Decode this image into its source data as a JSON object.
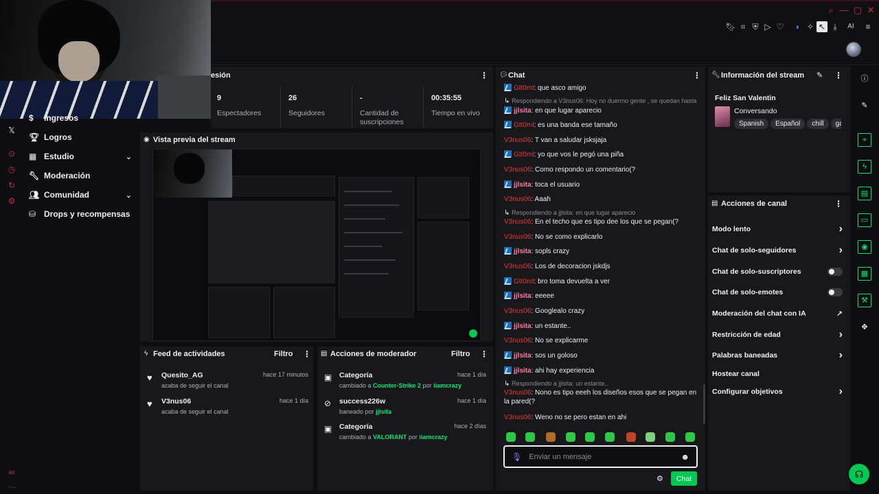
{
  "sidebar": {
    "items": [
      {
        "label": "Ingresos"
      },
      {
        "label": "Logros"
      },
      {
        "label": "Estudio"
      },
      {
        "label": "Moderación"
      },
      {
        "label": "Comunidad"
      },
      {
        "label": "Drops y recompensas"
      }
    ]
  },
  "session": {
    "title_fragment": "esión",
    "stats": [
      {
        "value": "9",
        "label": "Espectadores"
      },
      {
        "value": "26",
        "label": "Seguidores"
      },
      {
        "value": "-",
        "label": "Cantidad de suscripciones"
      },
      {
        "value": "00:35:55",
        "label": "Tiempo en vivo"
      }
    ]
  },
  "preview": {
    "title": "Vista previa del stream"
  },
  "activity": {
    "title": "Feed de actividades",
    "filter": "Filtro",
    "items": [
      {
        "user": "Quesito_AG",
        "desc": "acaba de seguir el canal",
        "time": "hace 17 minutos"
      },
      {
        "user": "V3nus06",
        "desc": "acaba de seguir el canal",
        "time": "hace 1 día"
      }
    ]
  },
  "modactions": {
    "title": "Acciones de moderador",
    "filter": "Filtro",
    "items": [
      {
        "title": "Categoría",
        "pre": "cambiado a",
        "target": "Counter-Strike 2",
        "by": "por",
        "who": "iiamcrazy",
        "time": "hace 1 día"
      },
      {
        "title": "success226w",
        "pre": "baneado por",
        "target": "jjlsita",
        "by": "",
        "who": "",
        "time": "hace 1 día"
      },
      {
        "title": "Categoría",
        "pre": "cambiado a",
        "target": "VALORANT",
        "by": "por",
        "who": "iiamcrazy",
        "time": "hace 2 días"
      }
    ]
  },
  "chat": {
    "title": "Chat",
    "placeholder": "Enviar un mensaje",
    "send_label": "Chat",
    "messages": [
      {
        "user": "Gtt0ml",
        "text": ": que asco amigo"
      },
      {
        "reply": "Respondiendo a V3nus06: Hoy no duermo gente , se quedan hasta ..."
      },
      {
        "user": "jjlsita",
        "text": ": en que lugar aparecio"
      },
      {
        "user": "Gtt0ml",
        "text": ": es una banda ese tamaño"
      },
      {
        "user": "V3nus06",
        "text": ": T van a saludar jsksjaja"
      },
      {
        "user": "Gtt0ml",
        "text": ": yo que vos le pegó una piña"
      },
      {
        "user": "V3nus06",
        "text": ": Como respondo un comentario(?"
      },
      {
        "user": "jjlsita",
        "text": ": toca el usuario"
      },
      {
        "user": "V3nus06",
        "text": ": Aaah"
      },
      {
        "reply": "Respondiendo a jjlsita: en que lugar aparecio"
      },
      {
        "user": "V3nus06",
        "text": ": En el techo que es tipo dee los que se pegan(?"
      },
      {
        "user": "V3nus06",
        "text": ": No se como explicarlo"
      },
      {
        "user": "jjlsita",
        "text": ": sopls crazy"
      },
      {
        "user": "V3nus06",
        "text": ": Los de decoracion jskdjs"
      },
      {
        "user": "Gtt0ml",
        "text": ": bro toma devuelta a ver"
      },
      {
        "user": "jjlsita",
        "text": ": eeeee"
      },
      {
        "user": "V3nus06",
        "text": ": Googlealo crazy"
      },
      {
        "user": "jjlsita",
        "text": ": un estante.."
      },
      {
        "user": "V3nus06",
        "text": ": No se explicarme"
      },
      {
        "user": "jjlsita",
        "text": ": sos un goloso"
      },
      {
        "user": "jjlsita",
        "text": ": ahi hay experiencia"
      },
      {
        "reply": "Respondiendo a jjlsita: un estante.."
      },
      {
        "user": "V3nus06",
        "text": ": Nono es tipo eeeh los diseños esos que se pegan en la pared(?"
      },
      {
        "user": "V3nus06",
        "text": ": Weno no se pero estan en ahi"
      }
    ]
  },
  "stream_info": {
    "title": "Información del stream",
    "stream_title": "Feliz San Valentin",
    "category": "Conversando",
    "tags": [
      "Spanish",
      "Español",
      "chill",
      "gar"
    ]
  },
  "channel_actions": {
    "title": "Acciones de canal",
    "items": [
      {
        "label": "Modo lento",
        "control": "chevron"
      },
      {
        "label": "Chat de solo-seguidores",
        "control": "chevron"
      },
      {
        "label": "Chat de solo-suscriptores",
        "control": "toggle"
      },
      {
        "label": "Chat de solo-emotes",
        "control": "toggle"
      },
      {
        "label": "Moderación del chat con IA",
        "control": "external"
      },
      {
        "label": "Restricción de edad",
        "control": "chevron"
      },
      {
        "label": "Palabras baneadas",
        "control": "chevron"
      },
      {
        "label": "Hostear canal",
        "control": "none"
      },
      {
        "label": "Configurar objetivos",
        "control": "chevron"
      }
    ]
  },
  "topbar": {
    "ai_label": "AI"
  },
  "watermark": "ax",
  "colors": {
    "accent": "#00e676",
    "brand_red": "#c52c4f",
    "panel": "#18181b",
    "bg": "#0e0e10"
  }
}
